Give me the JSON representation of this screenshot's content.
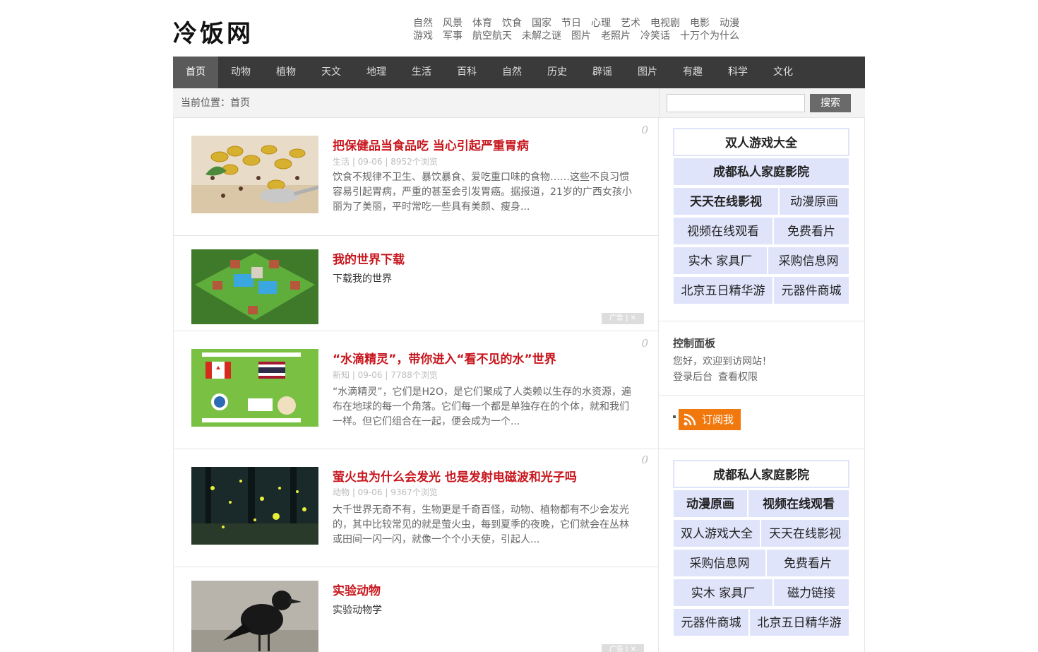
{
  "site": {
    "logo": "冷饭网"
  },
  "toplinks": {
    "row1": [
      "自然",
      "风景",
      "体育",
      "饮食",
      "国家",
      "节日",
      "心理",
      "艺术",
      "电视剧",
      "电影",
      "动漫"
    ],
    "row2": [
      "游戏",
      "军事",
      "航空航天",
      "未解之谜",
      "图片",
      "老照片",
      "冷笑话",
      "十万个为什么"
    ]
  },
  "nav": [
    "首页",
    "动物",
    "植物",
    "天文",
    "地理",
    "生活",
    "百科",
    "自然",
    "历史",
    "辟谣",
    "图片",
    "有趣",
    "科学",
    "文化"
  ],
  "breadcrumb": "当前位置：首页",
  "search": {
    "button": "搜索",
    "value": ""
  },
  "posts": [
    {
      "title": "把保健品当食品吃 当心引起严重胃病",
      "meta": "生活 | 09-06 | 8952个浏览",
      "desc": "饮食不规律不卫生、暴饮暴食、爱吃重口味的食物……这些不良习惯容易引起胃病，严重的甚至会引发胃癌。据报道，21岁的广西女孩小丽为了美丽，平时常吃一些具有美颜、瘦身...",
      "count": "0"
    },
    {
      "title": "我的世界下载",
      "sub": "下载我的世界",
      "ad": "广告 | ✕"
    },
    {
      "title": "“水滴精灵”，带你进入“看不见的水”世界",
      "meta": "新知 | 09-06 | 7788个浏览",
      "desc": "“水滴精灵”，它们是H2O，是它们聚成了人类赖以生存的水资源，遍布在地球的每一个角落。它们每一个都是单独存在的个体，就和我们一样。但它们组合在一起，便会成为一个...",
      "count": "0"
    },
    {
      "title": "萤火虫为什么会发光 也是发射电磁波和光子吗",
      "meta": "动物 | 09-06 | 9367个浏览",
      "desc": "大千世界无奇不有，生物更是千奇百怪，动物、植物都有不少会发光的，其中比较常见的就是萤火虫，每到夏季的夜晚，它们就会在丛林或田间一闪一闪，就像一个个小天使，引起人...",
      "count": "0"
    },
    {
      "title": "实验动物",
      "sub": "实验动物学",
      "ad": "广告 | ✕"
    }
  ],
  "sidebar": {
    "ads1": [
      "双人游戏大全",
      "成都私人家庭影院",
      "天天在线影视",
      "动漫原画",
      "视频在线观看",
      "免费看片",
      "实木 家具厂",
      "采购信息网",
      "北京五日精华游",
      "元器件商城"
    ],
    "control": {
      "title": "控制面板",
      "welcome": "您好，欢迎到访网站！",
      "login": "登录后台",
      "perm": "查看权限"
    },
    "rss": "订阅我",
    "ads2": [
      "成都私人家庭影院",
      "动漫原画",
      "视频在线观看",
      "双人游戏大全",
      "天天在线影视",
      "采购信息网",
      "免费看片",
      "实木 家具厂",
      "磁力链接",
      "元器件商城",
      "北京五日精华游"
    ]
  },
  "colors": {
    "accent": "#c8161d",
    "nav_bg": "#3a3a3a",
    "rss": "#f1780d",
    "ad_bg": "#e0e4fb"
  }
}
